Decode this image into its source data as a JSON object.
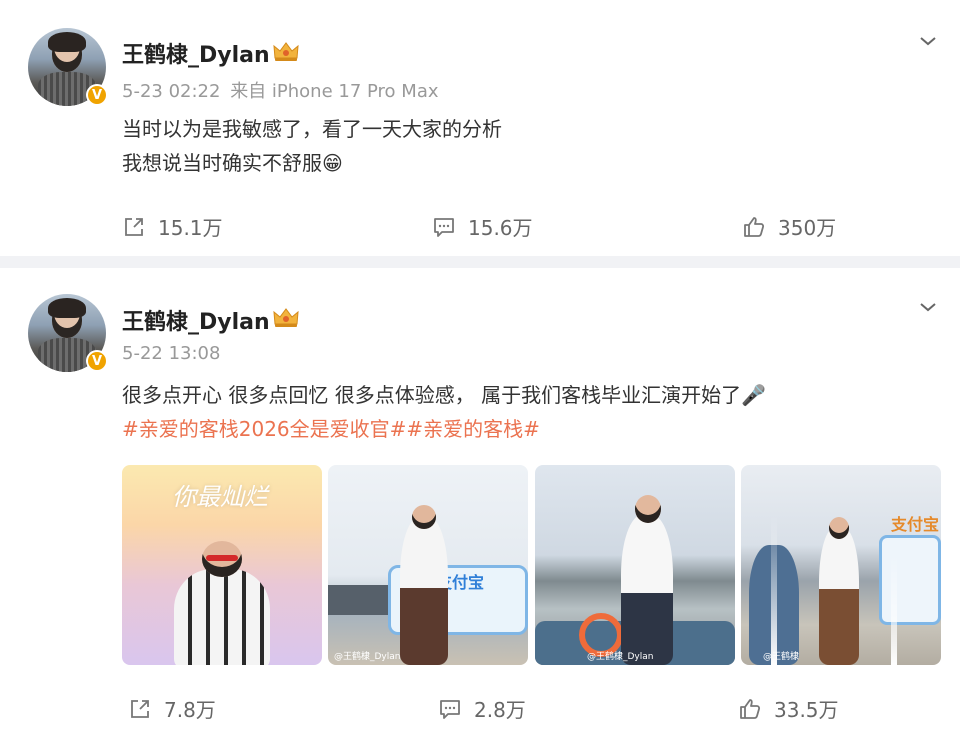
{
  "posts": [
    {
      "username": "王鹤棣_Dylan",
      "time": "5-23 02:22",
      "source": "来自 iPhone 17 Pro Max",
      "text_lines": [
        "当时以为是我敏感了，看了一天大家的分析",
        "我想说当时确实不舒服😁"
      ],
      "actions": {
        "reposts": "15.1万",
        "comments": "15.6万",
        "likes": "350万"
      }
    },
    {
      "username": "王鹤棣_Dylan",
      "time": "5-22 13:08",
      "text_lines": [
        "很多点开心 很多点回忆 很多点体验感， 属于我们客栈毕业汇演开始了🎤"
      ],
      "hashtags": "#亲爱的客栈2026全是爱收官##亲爱的客栈#",
      "images": [
        {
          "overlay_text": "你最灿烂",
          "caption": ""
        },
        {
          "overlay_text": "支付宝",
          "caption": "@王鹤棣_Dylan"
        },
        {
          "overlay_text": "",
          "caption": "@王鹤棣_Dylan"
        },
        {
          "overlay_text": "支付宝",
          "caption": "@王鹤棣"
        }
      ],
      "actions": {
        "reposts": "7.8万",
        "comments": "2.8万",
        "likes": "33.5万"
      }
    }
  ],
  "colors": {
    "accent": "#eb7350",
    "verified": "#f0a300",
    "meta": "#999999"
  }
}
